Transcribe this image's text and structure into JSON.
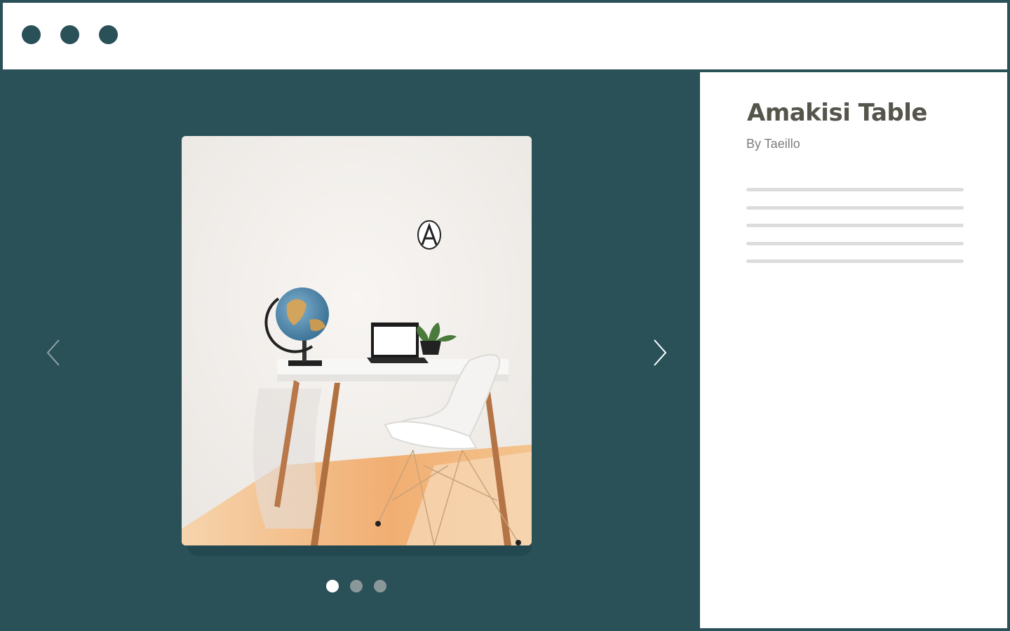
{
  "window": {
    "controls": [
      "close-dot",
      "minimize-dot",
      "maximize-dot"
    ]
  },
  "gallery": {
    "prev_icon": "chevron-left-icon",
    "next_icon": "chevron-right-icon",
    "image_subject": "white desk with globe, laptop, plant and white chair",
    "slide_count": 3,
    "active_slide": 1
  },
  "product": {
    "title": "Amakisi Table",
    "byline": "By Taeillo",
    "description_placeholder_lines": 5
  },
  "colors": {
    "background": "#2a5058",
    "title": "#55554b",
    "byline": "#7d7d7d",
    "placeholder_line": "#dcdcdc",
    "pager_inactive": "#8a9799",
    "pager_active": "#ffffff"
  }
}
